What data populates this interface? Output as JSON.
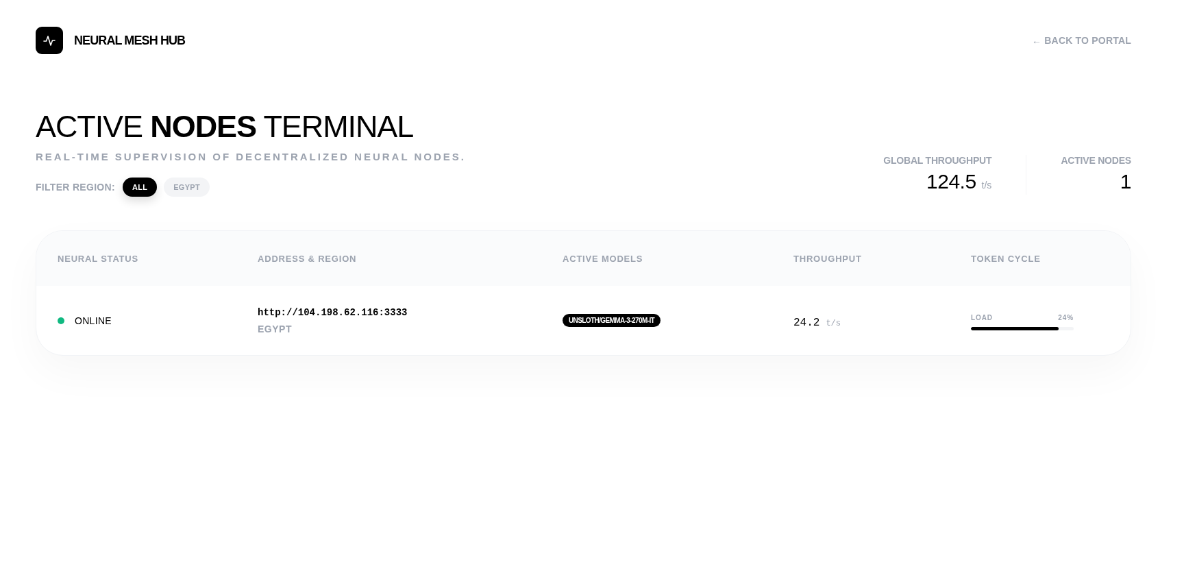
{
  "brand": {
    "name": "NEURAL MESH HUB"
  },
  "back_link": {
    "label": "← BACK TO PORTAL"
  },
  "hero": {
    "title": "ACTIVE **NODES** TERMINAL",
    "subtitle": "REAL-TIME SUPERVISION OF DECENTRALIZED NEURAL NODES."
  },
  "filter": {
    "label": "FILTER REGION:",
    "options": [
      {
        "label": "ALL",
        "selected": true
      },
      {
        "label": "EGYPT",
        "selected": false
      }
    ]
  },
  "stats": [
    {
      "label": "GLOBAL THROUGHPUT",
      "value": "124.5",
      "unit": "t/s"
    },
    {
      "label": "ACTIVE NODES",
      "value": "1"
    }
  ],
  "table": {
    "columns": [
      "NEURAL STATUS",
      "ADDRESS & REGION",
      "ACTIVE MODELS",
      "THROUGHPUT",
      "TOKEN CYCLE"
    ],
    "rows": [
      {
        "status": {
          "label": "ONLINE",
          "color": "#10b981"
        },
        "address": "http://104.198.62.116:3333",
        "region": "EGYPT",
        "models": [
          "UNSLOTH/GEMMA-3-270M-IT"
        ],
        "throughput": {
          "value": "24.2",
          "unit": "t/s"
        },
        "token_cycle": {
          "label": "LOAD",
          "value": "24%",
          "level": 0.85
        }
      }
    ]
  }
}
